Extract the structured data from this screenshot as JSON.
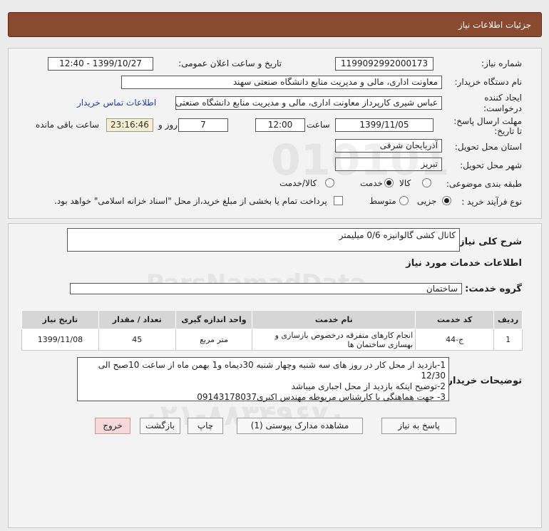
{
  "header": {
    "title": "جزئیات اطلاعات نیاز"
  },
  "need": {
    "number_label": "شماره نیاز:",
    "number_value": "1199092992000173",
    "announce_label": "تاریخ و ساعت اعلان عمومی:",
    "announce_value": "1399/10/27 - 12:40",
    "buyer_label": "نام دستگاه خریدار:",
    "buyer_value": "معاونت اداری، مالی و مدیریت منابع دانشگاه صنعتی سهند",
    "creator_label_1": "ایجاد کننده",
    "creator_label_2": "درخواست:",
    "creator_value": "عباس شیری کارپرداز معاونت اداری، مالی و مدیریت منابع دانشگاه صنعتی سهند",
    "contact_link": "اطلاعات تماس خریدار",
    "deadline_label_1": "مهلت ارسال پاسخ:",
    "deadline_label_2": "تا تاریخ:",
    "deadline_date": "1399/11/05",
    "time_label": "ساعت",
    "deadline_time": "12:00",
    "days_value": "7",
    "days_label": "روز و",
    "remaining_value": "23:16:46",
    "remaining_label": "ساعت باقی مانده",
    "province_label": "استان محل تحویل:",
    "province_value": "آذربایجان شرقی",
    "city_label": "شهر محل تحویل:",
    "city_value": "تبریز",
    "category_label": "طبقه بندی موضوعی:",
    "category_options": [
      "کالا",
      "خدمت",
      "کالا/خدمت"
    ],
    "category_selected": "خدمت",
    "process_label": "نوع فرآیند خرید :",
    "process_options": [
      "جزیی",
      "متوسط"
    ],
    "process_selected": "جزیی",
    "payment_note": "پرداخت تمام یا بخشی از مبلغ خرید،از محل \"اسناد خزانه اسلامی\" خواهد بود."
  },
  "summary": {
    "label": "شرح کلی نیاز:",
    "value": "کانال کشی گالوانیزه 0/6 میلیمتر"
  },
  "services": {
    "section_title": "اطلاعات خدمات مورد نیاز",
    "group_label": "گروه خدمت:",
    "group_value": "ساختمان",
    "columns": [
      "ردیف",
      "کد خدمت",
      "نام خدمت",
      "واحد اندازه گیری",
      "تعداد / مقدار",
      "تاریخ نیاز"
    ],
    "rows": [
      {
        "row": "1",
        "code": "ج-44",
        "name": "انجام کارهای متفرقه درخصوص بازسازی و بهسازی ساختمان ها",
        "unit": "متر مربع",
        "qty": "45",
        "date": "1399/11/08"
      }
    ]
  },
  "buyer_notes": {
    "label": "توضیحات خریدار:",
    "lines": [
      "1-بازدید از محل کار در روز های سه شنبه وچهار شنبه 30دیماه و1 بهمن ماه از ساعت 10صبح الی 12/30",
      "2-توضیح اینکه بازدید از محل اجباری میباشد",
      "3- جهت هماهنگی با کارشناس مربوطه مهندس اکبری09143178037"
    ]
  },
  "buttons": {
    "reply": "پاسخ به نیاز",
    "attachments": "مشاهده مدارک پیوستی (1)",
    "print": "چاپ",
    "back": "بازگشت",
    "exit": "خروج"
  },
  "watermark": {
    "brand": "ParsNamadData",
    "phone": "۰۲۱-۸۸۳۴۹۶۷۰"
  }
}
